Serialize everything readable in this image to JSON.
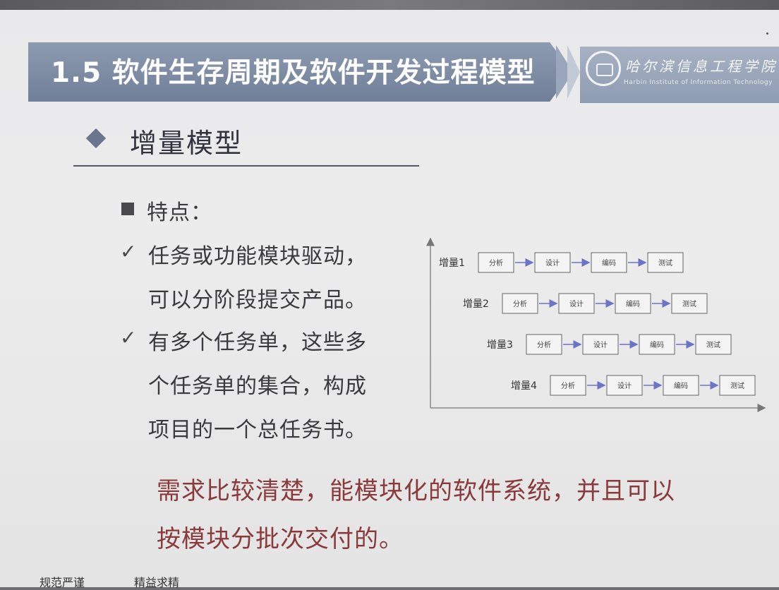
{
  "header": {
    "title": "1.5 软件生存周期及软件开发过程模型",
    "logo_cn": "哈尔滨信息工程学院",
    "logo_en": "Harbin Institute of Information Technology"
  },
  "section": {
    "title": "增量模型"
  },
  "features": {
    "heading": "特点：",
    "items": [
      {
        "lines": [
          "任务或功能模块驱动，",
          "可以分阶段提交产品。"
        ]
      },
      {
        "lines": [
          "有多个任务单，这些多",
          "个任务单的集合，构成",
          "项目的一个总任务书。"
        ]
      }
    ]
  },
  "diagram": {
    "increments": [
      {
        "label": "增量1",
        "steps": [
          "分析",
          "设计",
          "编码",
          "测试"
        ]
      },
      {
        "label": "增量2",
        "steps": [
          "分析",
          "设计",
          "编码",
          "测试"
        ]
      },
      {
        "label": "增量3",
        "steps": [
          "分析",
          "设计",
          "编码",
          "测试"
        ]
      },
      {
        "label": "增量4",
        "steps": [
          "分析",
          "设计",
          "编码",
          "测试"
        ]
      }
    ]
  },
  "summary": {
    "lines": [
      "需求比较清楚，能模块化的软件系统，并且可以",
      "按模块分批次交付的。"
    ]
  },
  "footer": {
    "left": "规范严谨",
    "right": "精益求精"
  },
  "colors": {
    "title_bar": "#6f7f98",
    "highlight": "#8a3a3a",
    "arrow": "#6b74c8"
  }
}
